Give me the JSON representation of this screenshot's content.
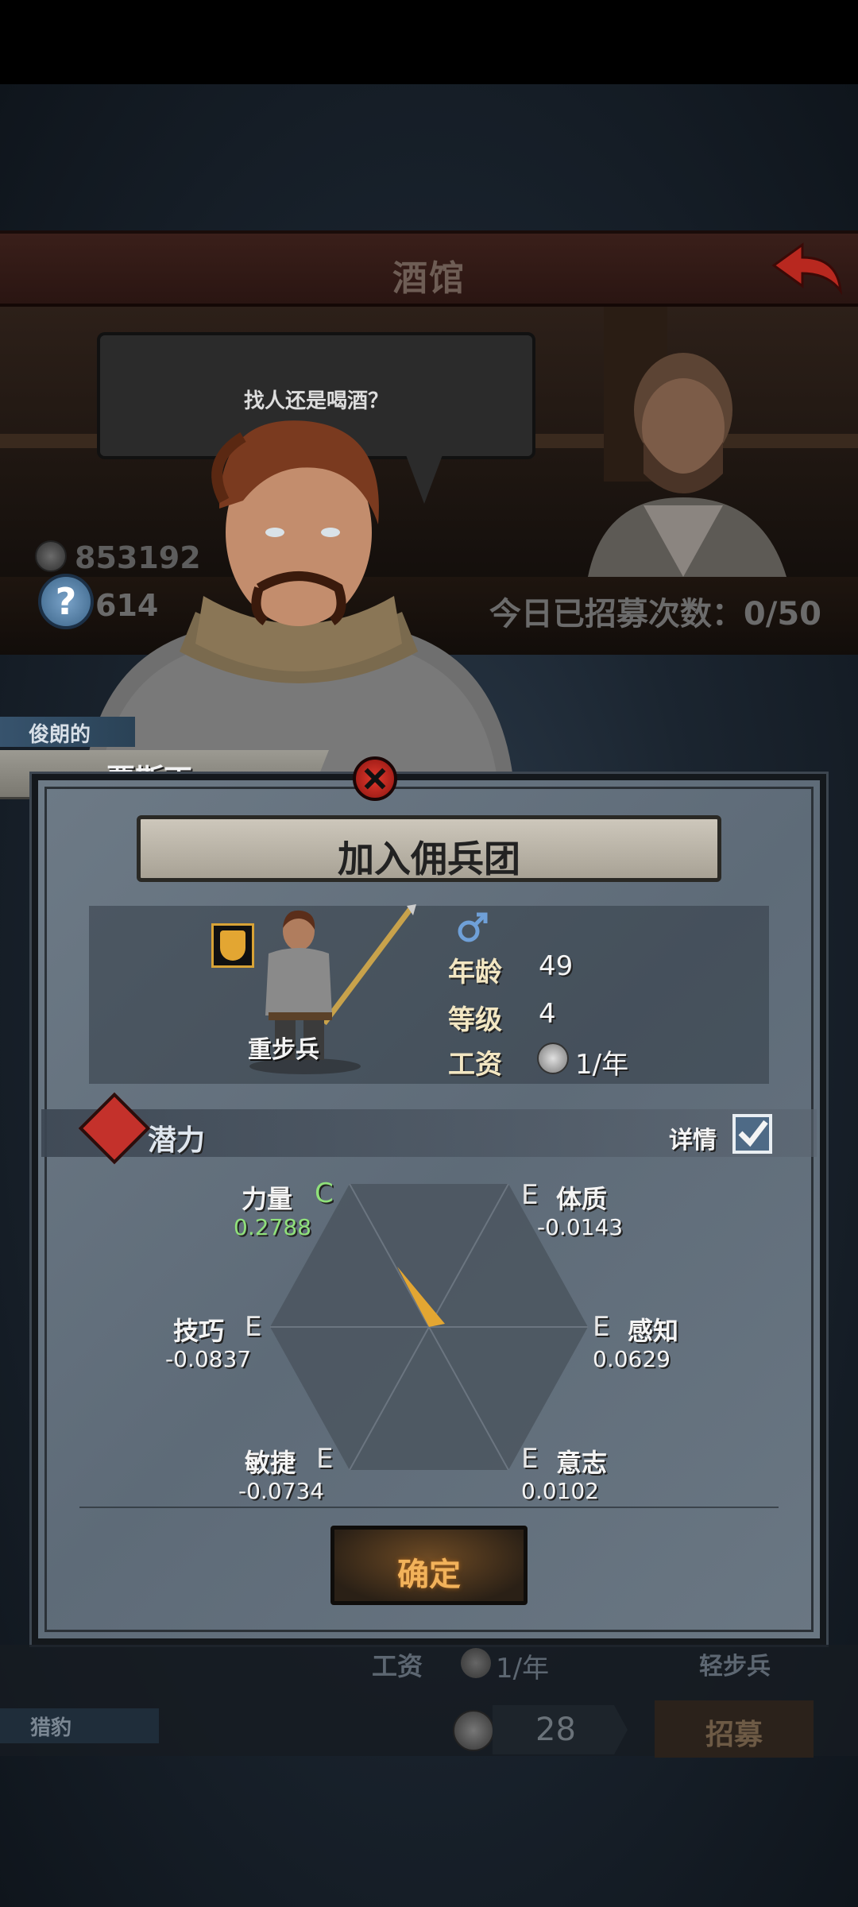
{
  "header": {
    "title": "酒馆"
  },
  "npc": {
    "speech": "找人还是喝酒？"
  },
  "resources": {
    "gold": "853192",
    "secondary": "614",
    "recruit_count": "今日已招募次数：0/50"
  },
  "hero": {
    "title": "俊朗的",
    "name": "贾斯丁"
  },
  "dialog": {
    "title": "加入佣兵团",
    "unit_type": "重步兵",
    "stats": {
      "age_label": "年龄",
      "age": "49",
      "level_label": "等级",
      "level": "4",
      "wage_label": "工资",
      "wage": "1/年"
    },
    "potential_label": "潜力",
    "details_label": "详情",
    "details_checked": true,
    "attributes": [
      {
        "name": "力量",
        "grade": "C",
        "value": "0.2788"
      },
      {
        "name": "体质",
        "grade": "E",
        "value": "-0.0143"
      },
      {
        "name": "感知",
        "grade": "E",
        "value": "0.0629"
      },
      {
        "name": "意志",
        "grade": "E",
        "value": "0.0102"
      },
      {
        "name": "敏捷",
        "grade": "E",
        "value": "-0.0734"
      },
      {
        "name": "技巧",
        "grade": "E",
        "value": "-0.0837"
      }
    ],
    "confirm_label": "确定"
  },
  "background_list": {
    "wage_label": "工资",
    "wage": "1/年",
    "unit_type": "轻步兵",
    "tag": "猎豹",
    "price": "28",
    "recruit_label": "招募"
  },
  "colors": {
    "accent": "#e3a632",
    "good": "#8fe07a",
    "danger": "#c4312b"
  }
}
